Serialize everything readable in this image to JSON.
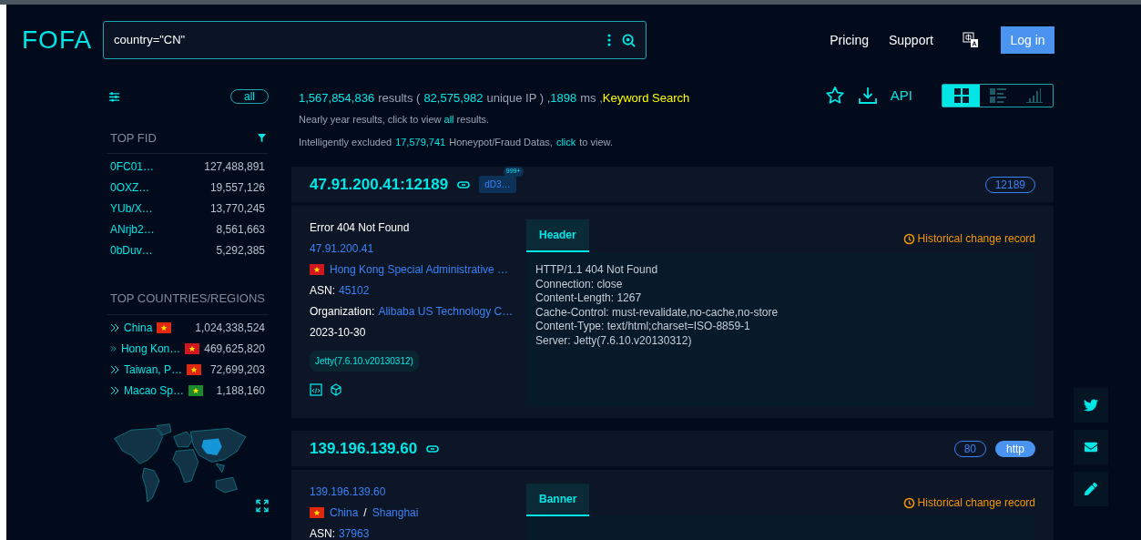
{
  "header": {
    "logo": "FOFA",
    "search": {
      "value": "country=\"CN\""
    },
    "nav": [
      "Pricing",
      "Support"
    ],
    "login": "Log in"
  },
  "sidebar": {
    "all": "all",
    "fid": {
      "title": "TOP FID",
      "rows": [
        {
          "name": "0FC01…",
          "count": "127,488,891"
        },
        {
          "name": "0OXZ…",
          "count": "19,557,126"
        },
        {
          "name": "YUb/X…",
          "count": "13,770,245"
        },
        {
          "name": "ANrjb2…",
          "count": "8,561,663"
        },
        {
          "name": "0bDuv…",
          "count": "5,292,385"
        }
      ]
    },
    "countries": {
      "title": "TOP COUNTRIES/REGIONS",
      "rows": [
        {
          "name": "China",
          "color": "#de2910",
          "count": "1,024,338,524"
        },
        {
          "name": "Hong Kon…",
          "color": "#d0161f",
          "count": "469,625,820"
        },
        {
          "name": "Taiwan, P…",
          "color": "#de2910",
          "count": "72,699,203"
        },
        {
          "name": "Macao Sp…",
          "color": "#1a8a2a",
          "count": "1,188,160"
        }
      ]
    }
  },
  "summary": {
    "results": "1,567,854,836",
    "results_label": "results (",
    "unique": "82,575,982",
    "unique_label": "unique IP ) ,",
    "ms": "1898",
    "ms_label": "ms ,",
    "mode": "Keyword Search",
    "line2": "Nearly year results, click to view **all** results.",
    "line3_a": "Intelligently excluded",
    "excluded": "17,579,741",
    "line3_b": "Honeypot/Fraud Datas,",
    "click": "click",
    "line3_c": "to view."
  },
  "actions": {
    "api": "API"
  },
  "views": [
    {
      "kind": "grid",
      "selected": true
    },
    {
      "kind": "list",
      "selected": false
    },
    {
      "kind": "stats",
      "selected": false
    }
  ],
  "results": [
    {
      "host": "47.91.200.41:12189",
      "fid": "dD3…",
      "fid_count": "999+",
      "badges": [
        {
          "text": "12189",
          "kind": "port"
        }
      ],
      "title": "Error 404 Not Found",
      "ip": "47.91.200.41",
      "color": "#d0161f",
      "location": [
        "Hong Kong Special Administrative …"
      ],
      "asn_label": "ASN:",
      "asn": "45102",
      "org_label": "Organization:",
      "org": "Alibaba US Technology C…",
      "date": "2023-10-30",
      "product": "Jetty(7.6.10.v20130312)",
      "tab": {
        "label": "Header",
        "selected": true
      },
      "history": "Historical change record",
      "lines": [
        "HTTP/1.1 404 Not Found",
        "Connection: close",
        "Content-Length: 1267",
        "Cache-Control: must-revalidate,no-cache,no-store",
        "Content-Type: text/html;charset=ISO-8859-1",
        "Server: Jetty(7.6.10.v20130312)"
      ]
    },
    {
      "host": "139.196.139.60",
      "badges": [
        {
          "text": "80",
          "kind": "port"
        },
        {
          "text": "http",
          "kind": "protocol"
        }
      ],
      "ip": "139.196.139.60",
      "color": "#de2910",
      "location": [
        "China",
        "Shanghai"
      ],
      "location_separator": "/",
      "asn_label": "ASN:",
      "asn": "37963",
      "tab": {
        "label": "Banner",
        "selected": true
      },
      "history": "Historical change record"
    }
  ]
}
